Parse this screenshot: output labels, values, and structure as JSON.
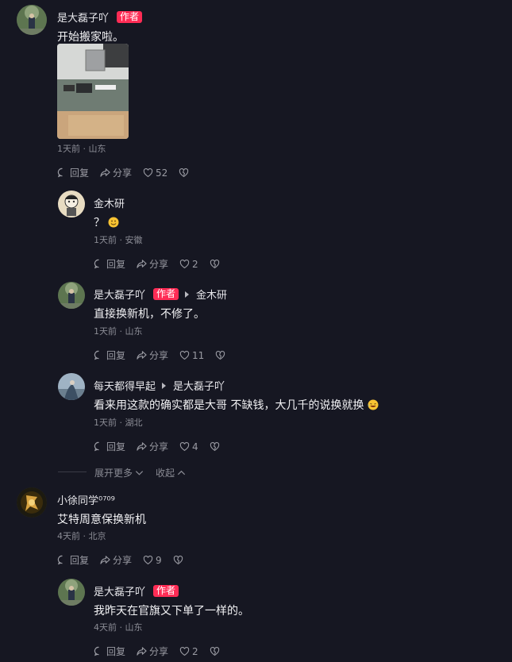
{
  "comments": [
    {
      "user": "是大磊子吖",
      "author_badge": "作者",
      "text": "开始搬家啦。",
      "meta": "1天前 · 山东",
      "reply": "回复",
      "share": "分享",
      "likes": "52"
    },
    {
      "user": "金木研",
      "text": "？",
      "meta": "1天前 · 安徽",
      "reply": "回复",
      "share": "分享",
      "likes": "2"
    },
    {
      "user": "是大磊子吖",
      "author_badge": "作者",
      "reply_to": "金木研",
      "text": "直接换新机，不修了。",
      "meta": "1天前 · 山东",
      "reply": "回复",
      "share": "分享",
      "likes": "11"
    },
    {
      "user": "每天都得早起",
      "reply_to": "是大磊子吖",
      "text": "看来用这款的确实都是大哥  不缺钱，大几千的说换就换",
      "meta": "1天前 · 湖北",
      "reply": "回复",
      "share": "分享",
      "likes": "4"
    },
    {
      "user": "小徐同学⁰⁷⁰⁹",
      "text": "艾特周意保换新机",
      "meta": "4天前 · 北京",
      "reply": "回复",
      "share": "分享",
      "likes": "9"
    },
    {
      "user": "是大磊子吖",
      "author_badge": "作者",
      "text": "我昨天在官旗又下单了一样的。",
      "meta": "4天前 · 山东",
      "reply": "回复",
      "share": "分享",
      "likes": "2"
    }
  ],
  "expand_more": "展开更多",
  "collapse": "收起",
  "colors": {
    "background": "#161722",
    "badge": "#fe2c55",
    "muted": "#8a8b94"
  },
  "icons": [
    "comment-icon",
    "share-icon",
    "heart-icon",
    "broken-heart-icon",
    "chevron-down-icon",
    "chevron-up-icon"
  ]
}
